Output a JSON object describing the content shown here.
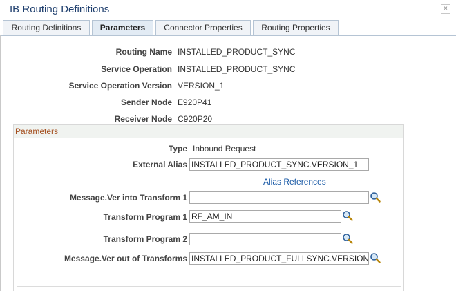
{
  "window": {
    "title": "IB Routing Definitions",
    "close_label": "×"
  },
  "tabs": [
    {
      "label": "Routing Definitions"
    },
    {
      "label": "Parameters"
    },
    {
      "label": "Connector Properties"
    },
    {
      "label": "Routing Properties"
    }
  ],
  "fields": {
    "routing_name": {
      "label": "Routing Name",
      "value": "INSTALLED_PRODUCT_SYNC"
    },
    "service_operation": {
      "label": "Service Operation",
      "value": "INSTALLED_PRODUCT_SYNC"
    },
    "service_operation_version": {
      "label": "Service Operation Version",
      "value": "VERSION_1"
    },
    "sender_node": {
      "label": "Sender Node",
      "value": "E920P41"
    },
    "receiver_node": {
      "label": "Receiver Node",
      "value": "C920P20"
    }
  },
  "parameters": {
    "title": "Parameters",
    "type": {
      "label": "Type",
      "value": "Inbound Request"
    },
    "external_alias": {
      "label": "External Alias",
      "value": "INSTALLED_PRODUCT_SYNC.VERSION_1"
    },
    "alias_references_link": "Alias References",
    "message_ver_into_transform": {
      "label": "Message.Ver into Transform 1",
      "value": ""
    },
    "transform_program_1": {
      "label": "Transform Program 1",
      "value": "RF_AM_IN"
    },
    "transform_program_2": {
      "label": "Transform Program 2",
      "value": ""
    },
    "message_ver_out": {
      "label": "Message.Ver out of Transforms",
      "value": "INSTALLED_PRODUCT_FULLSYNC.VERSION"
    }
  },
  "icons": {
    "lookup": "magnifier-lookup-icon"
  },
  "colors": {
    "title": "#1f3f6e",
    "group_title": "#a44f1f",
    "link": "#1a5aa6",
    "active_tab": "#e2ebf4"
  }
}
